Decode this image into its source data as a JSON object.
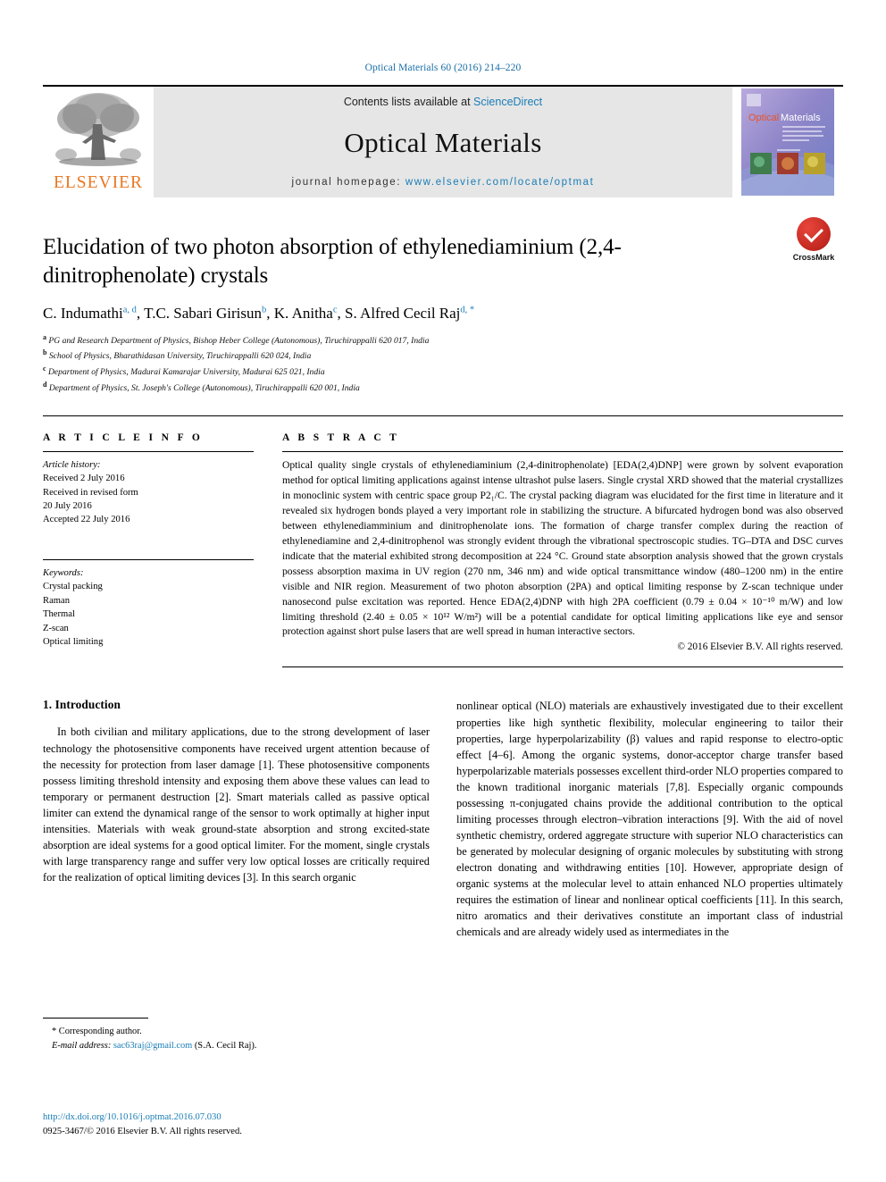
{
  "running_head": "Optical Materials 60 (2016) 214–220",
  "masthead": {
    "publisher_name": "ELSEVIER",
    "contents_prefix": "Contents lists available at ",
    "contents_link": "ScienceDirect",
    "journal_title": "Optical Materials",
    "homepage_prefix": "journal homepage: ",
    "homepage_link": "www.elsevier.com/locate/optmat",
    "cover_title_a": "Optical",
    "cover_title_b": "Materials"
  },
  "crossmark": {
    "label": "CrossMark"
  },
  "title": "Elucidation of two photon absorption of ethylenediaminium (2,4-dinitrophenolate) crystals",
  "authors": [
    {
      "name": "C. Indumathi",
      "marks": "a, d",
      "sep": ", "
    },
    {
      "name": "T.C. Sabari Girisun",
      "marks": "b",
      "sep": ", "
    },
    {
      "name": "K. Anitha",
      "marks": "c",
      "sep": ", "
    },
    {
      "name": "S. Alfred Cecil Raj",
      "marks": "d, *",
      "sep": ""
    }
  ],
  "affiliations": [
    {
      "mark": "a",
      "text": "PG and Research Department of Physics, Bishop Heber College (Autonomous), Tiruchirappalli 620 017, India"
    },
    {
      "mark": "b",
      "text": "School of Physics, Bharathidasan University, Tiruchirappalli 620 024, India"
    },
    {
      "mark": "c",
      "text": "Department of Physics, Madurai Kamarajar University, Madurai 625 021, India"
    },
    {
      "mark": "d",
      "text": "Department of Physics, St. Joseph's College (Autonomous), Tiruchirappalli 620 001, India"
    }
  ],
  "article_info": {
    "heading": "A R T I C L E  I N F O",
    "history_label": "Article history:",
    "history": [
      "Received 2 July 2016",
      "Received in revised form",
      "20 July 2016",
      "Accepted 22 July 2016"
    ],
    "keywords_label": "Keywords:",
    "keywords": [
      "Crystal packing",
      "Raman",
      "Thermal",
      "Z-scan",
      "Optical limiting"
    ]
  },
  "abstract": {
    "heading": "A B S T R A C T",
    "text": "Optical quality single crystals of ethylenediaminium (2,4-dinitrophenolate) [EDA(2,4)DNP] were grown by solvent evaporation method for optical limiting applications against intense ultrashot pulse lasers. Single crystal XRD showed that the material crystallizes in monoclinic system with centric space group P2₁/C. The crystal packing diagram was elucidated for the first time in literature and it revealed six hydrogen bonds played a very important role in stabilizing the structure. A bifurcated hydrogen bond was also observed between ethylenediamminium and dinitrophenolate ions. The formation of charge transfer complex during the reaction of ethylenediamine and 2,4-dinitrophenol was strongly evident through the vibrational spectroscopic studies. TG–DTA and DSC curves indicate that the material exhibited strong decomposition at 224 °C. Ground state absorption analysis showed that the grown crystals possess absorption maxima in UV region (270 nm, 346 nm) and wide optical transmittance window (480–1200 nm) in the entire visible and NIR region. Measurement of two photon absorption (2PA) and optical limiting response by Z-scan technique under nanosecond pulse excitation was reported. Hence EDA(2,4)DNP with high 2PA coefficient (0.79 ± 0.04 × 10⁻¹⁰ m/W) and low limiting threshold (2.40 ± 0.05 × 10¹² W/m²) will be a potential candidate for optical limiting applications like eye and sensor protection against short pulse lasers that are well spread in human interactive sectors.",
    "copyright": "© 2016 Elsevier B.V. All rights reserved."
  },
  "introduction": {
    "heading": "1. Introduction",
    "left_paragraph": "In both civilian and military applications, due to the strong development of laser technology the photosensitive components have received urgent attention because of the necessity for protection from laser damage [1]. These photosensitive components possess limiting threshold intensity and exposing them above these values can lead to temporary or permanent destruction [2]. Smart materials called as passive optical limiter can extend the dynamical range of the sensor to work optimally at higher input intensities. Materials with weak ground-state absorption and strong excited-state absorption are ideal systems for a good optical limiter. For the moment, single crystals with large transparency range and suffer very low optical losses are critically required for the realization of optical limiting devices [3]. In this search organic",
    "right_paragraph": "nonlinear optical (NLO) materials are exhaustively investigated due to their excellent properties like high synthetic flexibility, molecular engineering to tailor their properties, large hyperpolarizability (β) values and rapid response to electro-optic effect [4–6]. Among the organic systems, donor-acceptor charge transfer based hyperpolarizable materials possesses excellent third-order NLO properties compared to the known traditional inorganic materials [7,8]. Especially organic compounds possessing π-conjugated chains provide the additional contribution to the optical limiting processes through electron–vibration interactions [9]. With the aid of novel synthetic chemistry, ordered aggregate structure with superior NLO characteristics can be generated by molecular designing of organic molecules by substituting with strong electron donating and withdrawing entities [10]. However, appropriate design of organic systems at the molecular level to attain enhanced NLO properties ultimately requires the estimation of linear and nonlinear optical coefficients [11]. In this search, nitro aromatics and their derivatives constitute an important class of industrial chemicals and are already widely used as intermediates in the"
  },
  "footnote": {
    "corresponding": "* Corresponding author.",
    "email_label": "E-mail address:",
    "email": "sac63raj@gmail.com",
    "email_owner": "(S.A. Cecil Raj)."
  },
  "page_footer": {
    "doi": "http://dx.doi.org/10.1016/j.optmat.2016.07.030",
    "issn_line": "0925-3467/© 2016 Elsevier B.V. All rights reserved."
  },
  "colors": {
    "link_blue": "#1a7db6",
    "elsevier_orange": "#e87722",
    "banner_gray": "#e6e6e6",
    "crossmark_red": "#c0271e"
  }
}
